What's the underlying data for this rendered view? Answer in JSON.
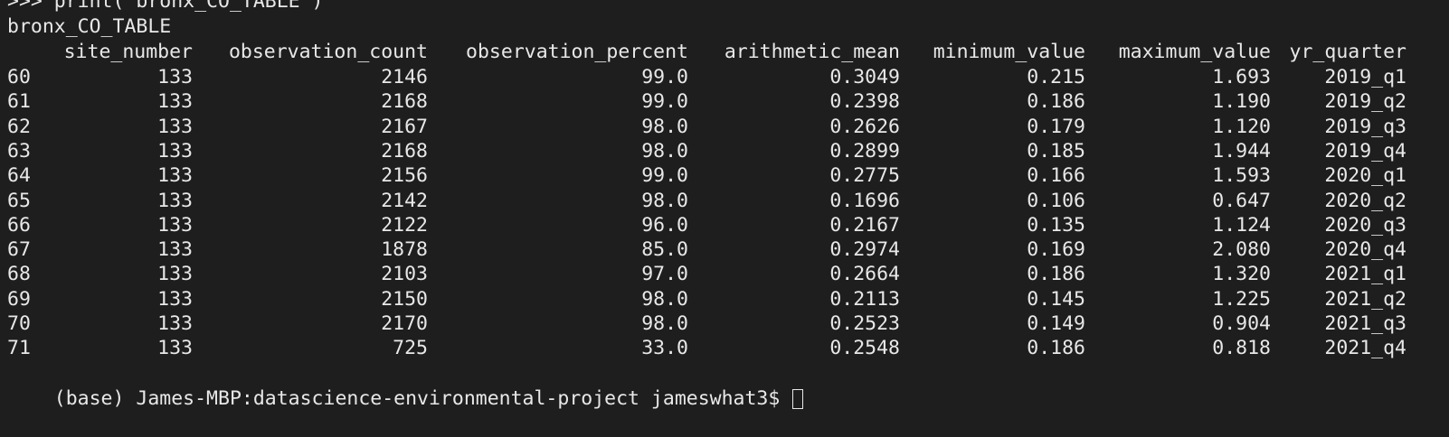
{
  "terminal": {
    "previous_command": ">>> print(\"bronx_CO_TABLE\")",
    "table_name": "bronx_CO_TABLE",
    "columns": [
      "site_number",
      "observation_count",
      "observation_percent",
      "arithmetic_mean",
      "minimum_value",
      "maximum_value",
      "yr_quarter"
    ],
    "rows": [
      {
        "index": "60",
        "site_number": "133",
        "observation_count": "2146",
        "observation_percent": "99.0",
        "arithmetic_mean": "0.3049",
        "minimum_value": "0.215",
        "maximum_value": "1.693",
        "yr_quarter": "2019_q1"
      },
      {
        "index": "61",
        "site_number": "133",
        "observation_count": "2168",
        "observation_percent": "99.0",
        "arithmetic_mean": "0.2398",
        "minimum_value": "0.186",
        "maximum_value": "1.190",
        "yr_quarter": "2019_q2"
      },
      {
        "index": "62",
        "site_number": "133",
        "observation_count": "2167",
        "observation_percent": "98.0",
        "arithmetic_mean": "0.2626",
        "minimum_value": "0.179",
        "maximum_value": "1.120",
        "yr_quarter": "2019_q3"
      },
      {
        "index": "63",
        "site_number": "133",
        "observation_count": "2168",
        "observation_percent": "98.0",
        "arithmetic_mean": "0.2899",
        "minimum_value": "0.185",
        "maximum_value": "1.944",
        "yr_quarter": "2019_q4"
      },
      {
        "index": "64",
        "site_number": "133",
        "observation_count": "2156",
        "observation_percent": "99.0",
        "arithmetic_mean": "0.2775",
        "minimum_value": "0.166",
        "maximum_value": "1.593",
        "yr_quarter": "2020_q1"
      },
      {
        "index": "65",
        "site_number": "133",
        "observation_count": "2142",
        "observation_percent": "98.0",
        "arithmetic_mean": "0.1696",
        "minimum_value": "0.106",
        "maximum_value": "0.647",
        "yr_quarter": "2020_q2"
      },
      {
        "index": "66",
        "site_number": "133",
        "observation_count": "2122",
        "observation_percent": "96.0",
        "arithmetic_mean": "0.2167",
        "minimum_value": "0.135",
        "maximum_value": "1.124",
        "yr_quarter": "2020_q3"
      },
      {
        "index": "67",
        "site_number": "133",
        "observation_count": "1878",
        "observation_percent": "85.0",
        "arithmetic_mean": "0.2974",
        "minimum_value": "0.169",
        "maximum_value": "2.080",
        "yr_quarter": "2020_q4"
      },
      {
        "index": "68",
        "site_number": "133",
        "observation_count": "2103",
        "observation_percent": "97.0",
        "arithmetic_mean": "0.2664",
        "minimum_value": "0.186",
        "maximum_value": "1.320",
        "yr_quarter": "2021_q1"
      },
      {
        "index": "69",
        "site_number": "133",
        "observation_count": "2150",
        "observation_percent": "98.0",
        "arithmetic_mean": "0.2113",
        "minimum_value": "0.145",
        "maximum_value": "1.225",
        "yr_quarter": "2021_q2"
      },
      {
        "index": "70",
        "site_number": "133",
        "observation_count": "2170",
        "observation_percent": "98.0",
        "arithmetic_mean": "0.2523",
        "minimum_value": "0.149",
        "maximum_value": "0.904",
        "yr_quarter": "2021_q3"
      },
      {
        "index": "71",
        "site_number": "133",
        "observation_count": "725",
        "observation_percent": "33.0",
        "arithmetic_mean": "0.2548",
        "minimum_value": "0.186",
        "maximum_value": "0.818",
        "yr_quarter": "2021_q4"
      }
    ],
    "prompt": "(base) James-MBP:datascience-environmental-project jameswhat3$",
    "colors": {
      "background": "#1e1e1e",
      "foreground": "#e8e8e8"
    }
  }
}
